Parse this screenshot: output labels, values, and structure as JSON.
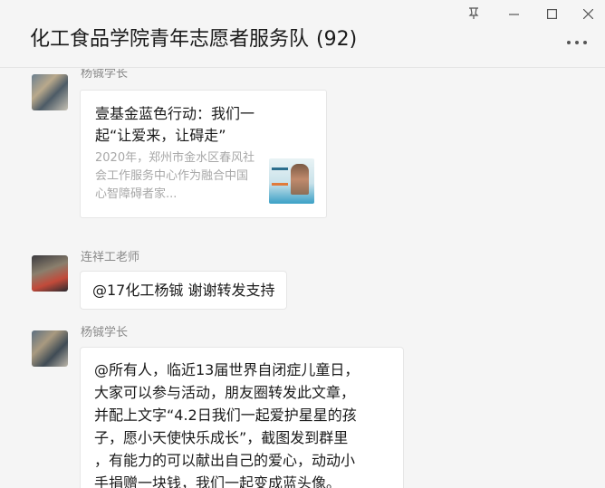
{
  "window": {
    "title": "化工食品学院青年志愿者服务队",
    "member_count": "(92)",
    "pin_icon": "pin-icon",
    "controls": [
      "minimize-icon",
      "maximize-icon",
      "close-icon",
      "more-icon"
    ]
  },
  "messages": [
    {
      "sender": "杨铖学长",
      "type": "link-card",
      "card": {
        "title": "壹基金蓝色行动：我们一起“让爱来，让碍走”",
        "description": "2020年，郑州市金水区春风社会工作服务中心作为融合中国心智障碍者家..."
      }
    },
    {
      "sender": "连祥工老师",
      "type": "text",
      "text": "@17化工杨铖 谢谢转发支持"
    },
    {
      "sender": "杨铖学长",
      "type": "text",
      "lines": [
        "@所有人，临近13届世界自闭症儿童日，",
        "大家可以参与活动，朋友圈转发此文章，",
        "并配上文字“4.2日我们一起爱护星星的孩",
        "子，愿小天使快乐成长”，截图发到群里",
        "，有能力的可以献出自己的爱心，动动小",
        "手捐赠一块钱，我们一起变成蓝头像。"
      ]
    }
  ]
}
